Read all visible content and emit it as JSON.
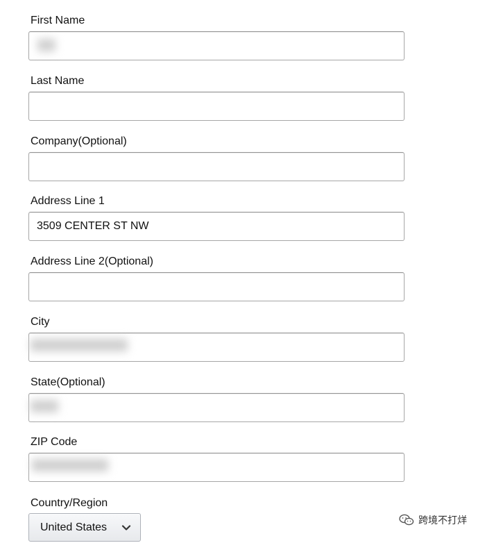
{
  "form": {
    "first_name": {
      "label": "First Name",
      "value": ""
    },
    "last_name": {
      "label": "Last Name",
      "value": ""
    },
    "company": {
      "label": "Company(Optional)",
      "value": ""
    },
    "address_line_1": {
      "label": "Address Line 1",
      "value": "3509 CENTER ST NW"
    },
    "address_line_2": {
      "label": "Address Line 2(Optional)",
      "value": ""
    },
    "city": {
      "label": "City",
      "value": ""
    },
    "state": {
      "label": "State(Optional)",
      "value": ""
    },
    "zip_code": {
      "label": "ZIP Code",
      "value": ""
    },
    "country": {
      "label": "Country/Region",
      "selected": "United States"
    }
  },
  "watermark": {
    "text": "跨境不打烊",
    "icon": "wechat-icon"
  },
  "colors": {
    "input_border": "#a6a6a6",
    "select_bg_top": "#f7f8fa",
    "select_bg_bottom": "#e7e9ec",
    "label_text": "#111111"
  }
}
